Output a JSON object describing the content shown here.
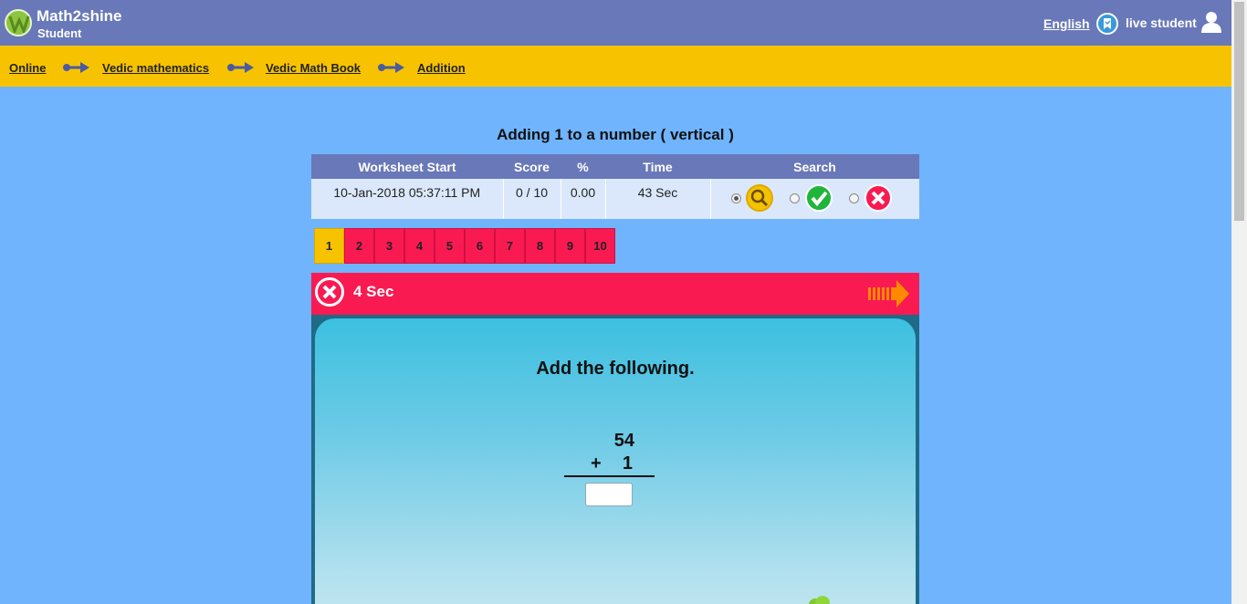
{
  "header": {
    "brand": "Math2shine",
    "role": "Student",
    "language": "English",
    "user_name": "live student"
  },
  "breadcrumb": [
    "Online",
    "Vedic mathematics",
    "Vedic Math Book",
    "Addition"
  ],
  "worksheet": {
    "title": "Adding 1 to a number ( vertical )",
    "columns": [
      "Worksheet Start",
      "Score",
      "%",
      "Time",
      "Search"
    ],
    "row": {
      "start": "10-Jan-2018 05:37:11 PM",
      "score": "0 / 10",
      "percent": "0.00",
      "time": "43 Sec"
    },
    "search_filters": [
      {
        "icon": "magnifier-icon",
        "selected": true,
        "color": "#f3c300"
      },
      {
        "icon": "check-icon",
        "selected": false,
        "color": "#1fb53a"
      },
      {
        "icon": "cross-icon",
        "selected": false,
        "color": "#f91a52"
      }
    ]
  },
  "question_tabs": [
    "1",
    "2",
    "3",
    "4",
    "5",
    "6",
    "7",
    "8",
    "9",
    "10"
  ],
  "active_question": "1",
  "question": {
    "timer": "4 Sec",
    "instruction": "Add the following.",
    "top_number": "54",
    "operator": "+",
    "bottom_number": "1",
    "answer": ""
  },
  "colors": {
    "header": "#6878b8",
    "breadcrumb_bar": "#f7c300",
    "background": "#70b4fd",
    "accent_red": "#f91a52"
  }
}
